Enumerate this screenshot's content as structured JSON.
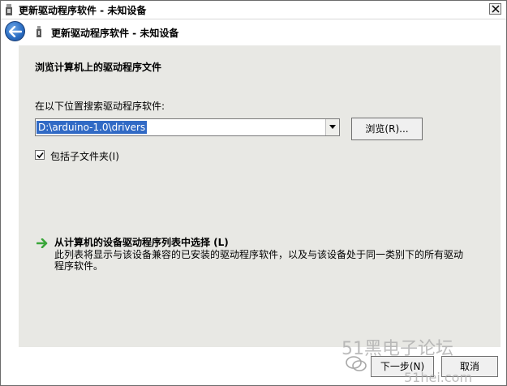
{
  "window": {
    "title": "更新驱动程序软件 - 未知设备"
  },
  "nav": {
    "title": "更新驱动程序软件 - 未知设备"
  },
  "main": {
    "heading": "浏览计算机上的驱动程序文件",
    "search_label": "在以下位置搜索驱动程序软件:",
    "path_value": "D:\\arduino-1.0\\drivers",
    "browse_label": "浏览(R)...",
    "include_subfolders_label": "包括子文件夹(I)",
    "include_subfolders_checked": true,
    "pick_link_title": "从计算机的设备驱动程序列表中选择 (L)",
    "pick_link_desc": "此列表将显示与该设备兼容的已安装的驱动程序软件，以及与该设备处于同一类别下的所有驱动程序软件。"
  },
  "footer": {
    "next_label": "下一步(N)",
    "cancel_label": "取消"
  },
  "watermark": {
    "text": "51黑电子论坛",
    "site": "51hei.com"
  },
  "colors": {
    "accent": "#316ac5",
    "content_bg": "#e8e8e4",
    "link_arrow": "#3aa63a"
  }
}
